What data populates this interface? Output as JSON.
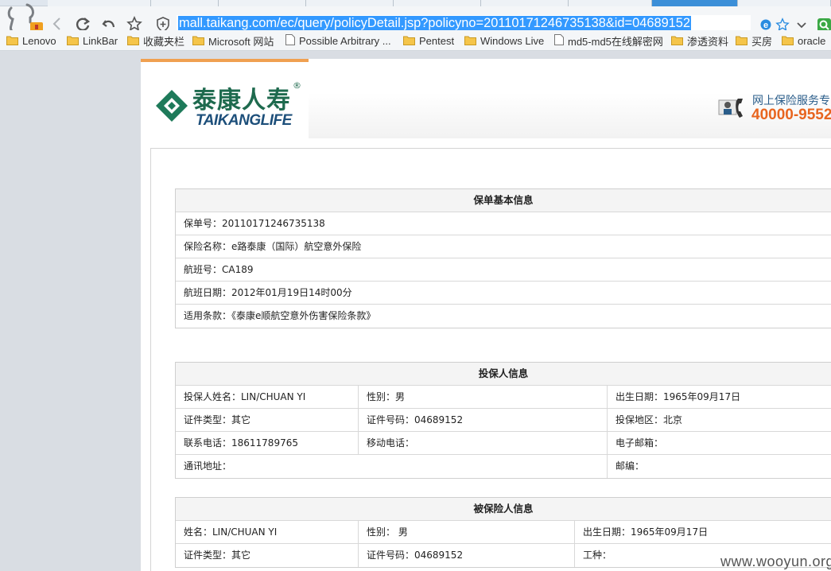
{
  "browser": {
    "url": "mall.taikang.com/ec/query/policyDetail.jsp?policyno=20110171246735138&id=04689152",
    "bookmarks": [
      {
        "label": "Lenovo",
        "icon": "folder-icon"
      },
      {
        "label": "LinkBar",
        "icon": "folder-icon"
      },
      {
        "label": "收藏夹栏",
        "icon": "folder-icon"
      },
      {
        "label": "Microsoft 网站",
        "icon": "folder-icon"
      },
      {
        "label": "Possible Arbitrary ...",
        "icon": "page-icon"
      },
      {
        "label": "Pentest",
        "icon": "folder-icon"
      },
      {
        "label": "Windows Live",
        "icon": "folder-icon"
      },
      {
        "label": "md5-md5在线解密网",
        "icon": "page-icon"
      },
      {
        "label": "渗透资料",
        "icon": "folder-icon"
      },
      {
        "label": "买房",
        "icon": "folder-icon"
      },
      {
        "label": "oracle",
        "icon": "folder-icon"
      }
    ]
  },
  "site": {
    "logo_cn": "泰康人寿",
    "logo_en": "TAIKANGLIFE",
    "logo_reg": "®",
    "hotline_label": "网上保险服务专",
    "hotline_number": "40000-9552"
  },
  "policy_basic": {
    "title": "保单基本信息",
    "rows": [
      "保单号：20110171246735138",
      "保险名称：e路泰康（国际）航空意外保险",
      "航班号：CA189",
      "航班日期：2012年01月19日14时00分",
      "适用条款：《泰康e顺航空意外伤害保险条款》"
    ]
  },
  "applicant": {
    "title": "投保人信息",
    "rows": [
      [
        "投保人姓名：LIN/CHUAN YI",
        "性别：男",
        "出生日期：1965年09月17日"
      ],
      [
        "证件类型：其它",
        "证件号码：04689152",
        "投保地区：北京"
      ],
      [
        "联系电话：18611789765",
        "移动电话：",
        "电子邮箱："
      ],
      [
        "通讯地址：",
        "",
        "邮编："
      ]
    ]
  },
  "insured": {
    "title": "被保险人信息",
    "rows": [
      [
        "姓名：LIN/CHUAN YI",
        "性别： 男",
        "出生日期：1965年09月17日"
      ],
      [
        "证件类型：其它",
        "证件号码：04689152",
        "工种："
      ]
    ]
  },
  "watermark": "www.wooyun.org",
  "colors": {
    "url_highlight": "#3399ff",
    "brand_green": "#1e6a4e",
    "brand_blue": "#1d4f7a",
    "hotline_orange": "#e8651f",
    "accent_orange": "#f0a050"
  }
}
